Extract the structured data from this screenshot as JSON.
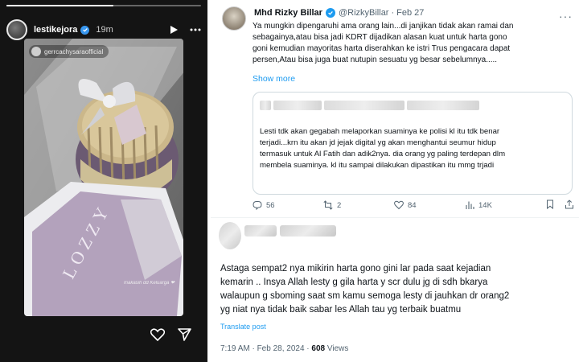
{
  "story": {
    "progress": 0.55,
    "username": "lestikejora",
    "time": "19m",
    "mention": "gerrcachysaraofficial",
    "caption_sticker": "makasih dd Keluarga ❤",
    "icons": {
      "play": "play-icon",
      "more": "more-horizontal-icon",
      "like": "heart-icon",
      "share": "send-icon"
    }
  },
  "tweet": {
    "name": "Mhd Rizky Billar",
    "handle": "@RizkyBillar",
    "date": "Feb 27",
    "lines": [
      "Ya mungkin dipengaruhi ama orang lain...di janjikan tidak akan ramai dan",
      "sebagainya,atau bisa jadi KDRT dijadikan alasan kuat untuk harta gono",
      "goni kemudian mayoritas harta diserahkan ke istri Trus pengacara dapat",
      "persen,Atau bisa juga buat nutupin sesuatu yg besar sebelumnya....."
    ],
    "show_more": "Show more",
    "quote_lines": [
      "Lesti tdk akan gegabah melaporkan suaminya ke polisi kl itu tdk benar",
      "terjadi...krn itu akan jd jejak digital yg akan menghantui seumur hidup",
      "termasuk untuk Al Fatih dan adik2nya. dia orang yg paling terdepan dlm",
      "membela suaminya. kl itu sampai dilakukan dipastikan itu mmg trjadi"
    ],
    "stats": {
      "replies": "56",
      "reposts": "2",
      "likes": "84",
      "views": "14K"
    }
  },
  "reply": {
    "lines": [
      "Astaga sempat2 nya mikirin harta gono gini lar pada saat kejadian",
      "kemarin  .. Insya Allah lesty g gila harta y scr  dulu jg di sdh bkarya",
      "walaupun g sboming saat sm kamu   semoga lesty di jauhkan dr orang2",
      "yg niat nya tidak  baik  sabar les Allah tau yg terbaik buatmu"
    ],
    "translate": "Translate post",
    "time": "7:19 AM · Feb 28, 2024 · ",
    "views_count": "608",
    "views_label": " Views"
  },
  "colors": {
    "x_blue": "#1d9bf0",
    "muted": "#536471",
    "ig_verified": "#3897f0"
  }
}
